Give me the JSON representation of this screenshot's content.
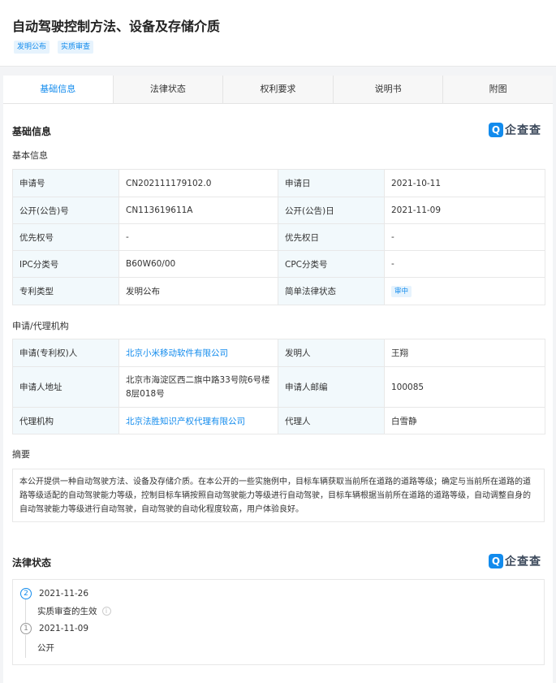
{
  "page_title": "自动驾驶控制方法、设备及存储介质",
  "tags": [
    "发明公布",
    "实质审查"
  ],
  "tabs": [
    "基础信息",
    "法律状态",
    "权利要求",
    "说明书",
    "附图"
  ],
  "basic_section": {
    "title": "基础信息",
    "logo_mark": "Q",
    "logo_text": "企查查",
    "subtitle": "基本信息",
    "rows": [
      {
        "k1": "申请号",
        "v1": "CN202111179102.0",
        "k2": "申请日",
        "v2": "2021-10-11"
      },
      {
        "k1": "公开(公告)号",
        "v1": "CN113619611A",
        "k2": "公开(公告)日",
        "v2": "2021-11-09"
      },
      {
        "k1": "优先权号",
        "v1": "-",
        "k2": "优先权日",
        "v2": "-"
      },
      {
        "k1": "IPC分类号",
        "v1": "B60W60/00",
        "k2": "CPC分类号",
        "v2": "-"
      },
      {
        "k1": "专利类型",
        "v1": "发明公布",
        "k2": "简单法律状态",
        "v2": "审中"
      }
    ]
  },
  "agency_section": {
    "subtitle": "申请/代理机构",
    "rows": [
      {
        "k1": "申请(专利权)人",
        "v1": "北京小米移动软件有限公司",
        "k2": "发明人",
        "v2": "王翔"
      },
      {
        "k1": "申请人地址",
        "v1": "北京市海淀区西二旗中路33号院6号楼8层018号",
        "k2": "申请人邮编",
        "v2": "100085"
      },
      {
        "k1": "代理机构",
        "v1": "北京法胜知识产权代理有限公司",
        "k2": "代理人",
        "v2": "白雪静"
      }
    ]
  },
  "abstract": {
    "subtitle": "摘要",
    "text": "本公开提供一种自动驾驶方法、设备及存储介质。在本公开的一些实施例中，目标车辆获取当前所在道路的道路等级；确定与当前所在道路的道路等级适配的自动驾驶能力等级，控制目标车辆按照自动驾驶能力等级进行自动驾驶，目标车辆根据当前所在道路的道路等级，自动调整自身的自动驾驶能力等级进行自动驾驶，自动驾驶的自动化程度较高，用户体验良好。"
  },
  "legal_section": {
    "title": "法律状态",
    "logo_mark": "Q",
    "logo_text": "企查查",
    "events": [
      {
        "num": "2",
        "date": "2021-11-26",
        "desc": "实质审查的生效",
        "info_icon": "i"
      },
      {
        "num": "1",
        "date": "2021-11-09",
        "desc": "公开"
      }
    ]
  }
}
